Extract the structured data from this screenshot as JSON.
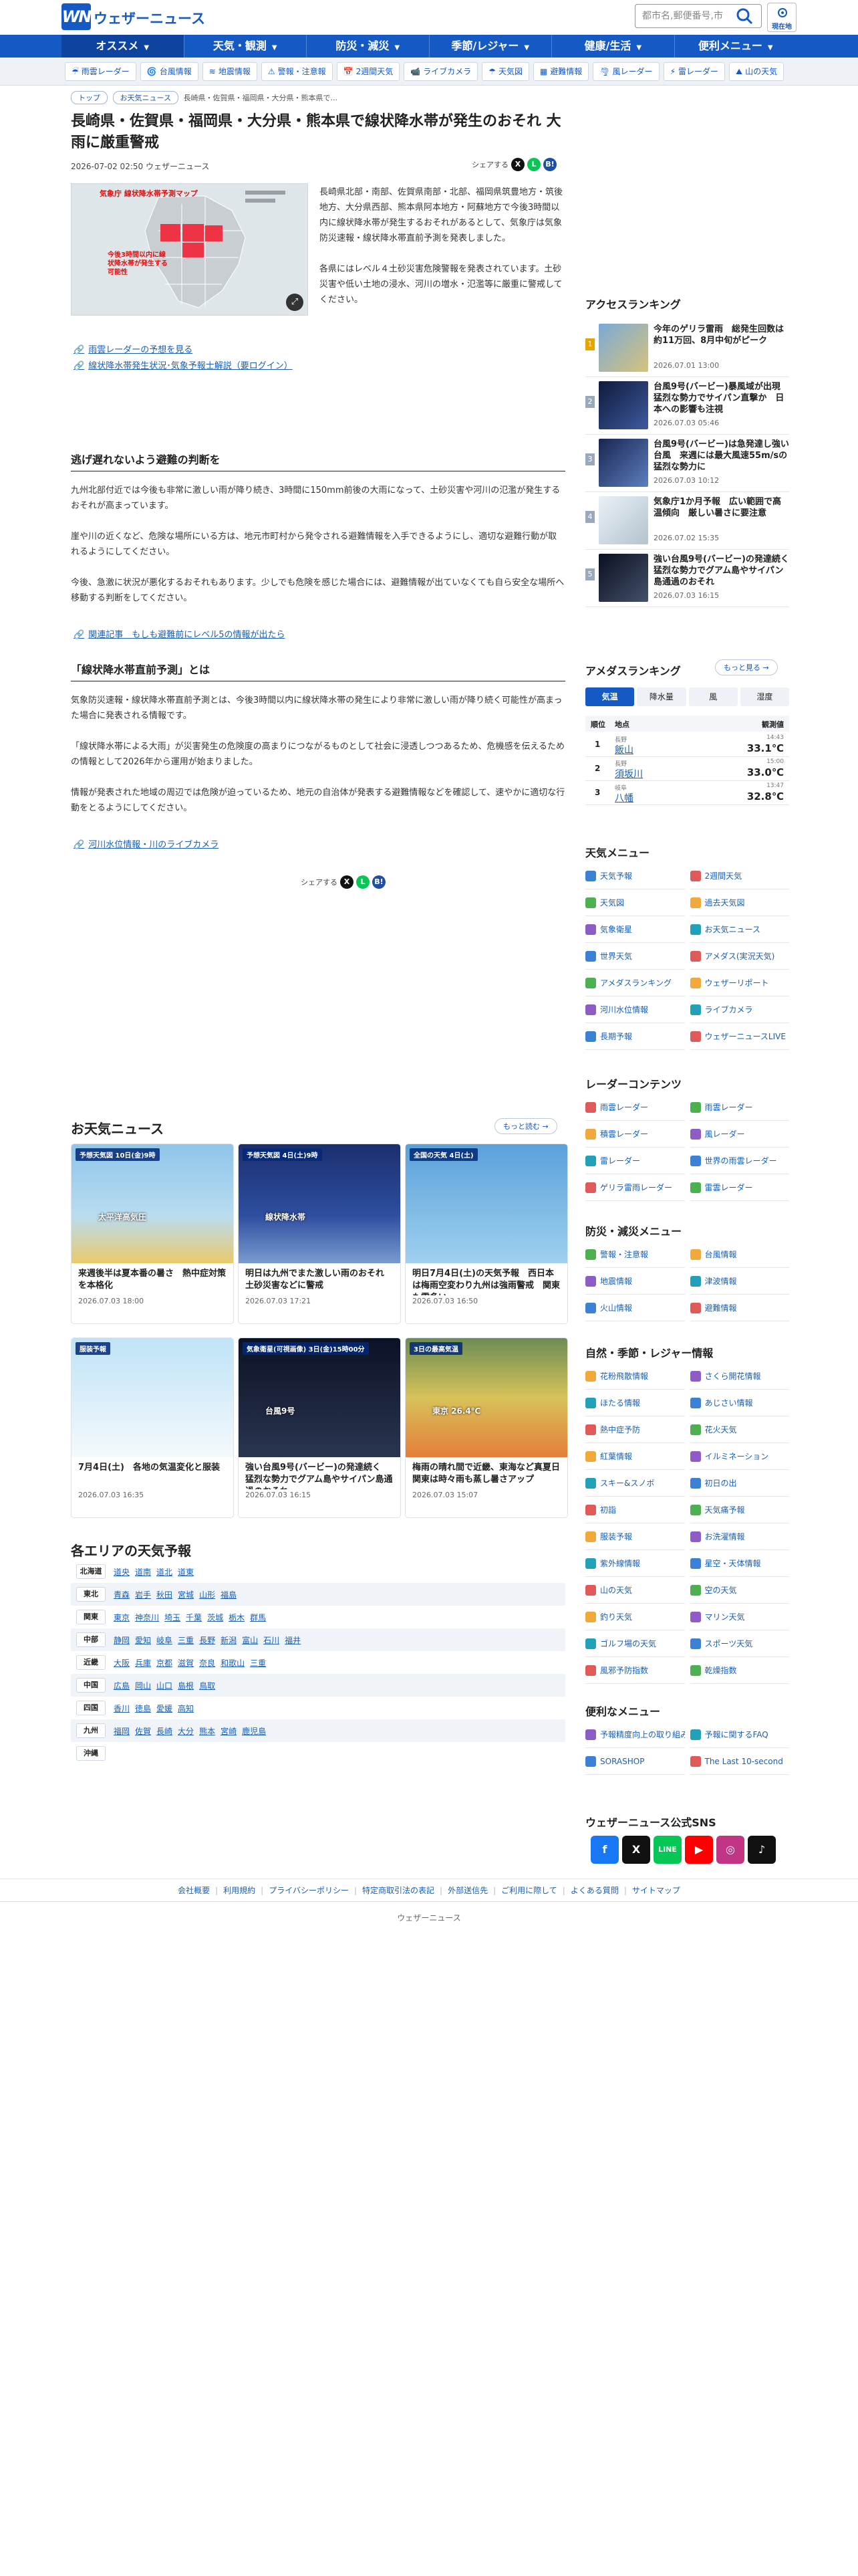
{
  "header": {
    "logo_text": "ウェザーニュース",
    "search_placeholder": "都市名,郵便番号,市",
    "location_label": "現在地"
  },
  "gnav": [
    "オススメ",
    "天気・観測",
    "防災・減災",
    "季節/レジャー",
    "健康/生活",
    "便利メニュー"
  ],
  "subnav": [
    {
      "icon": "☔",
      "label": "雨雲レーダー"
    },
    {
      "icon": "🌀",
      "label": "台風情報"
    },
    {
      "icon": "≋",
      "label": "地震情報"
    },
    {
      "icon": "⚠",
      "label": "警報・注意報"
    },
    {
      "icon": "📅",
      "label": "2週間天気"
    },
    {
      "icon": "📹",
      "label": "ライブカメラ"
    },
    {
      "icon": "☂",
      "label": "天気図"
    },
    {
      "icon": "▦",
      "label": "避難情報"
    },
    {
      "icon": "🌪",
      "label": "風レーダー"
    },
    {
      "icon": "⚡",
      "label": "雷レーダー"
    },
    {
      "icon": "⛰",
      "label": "山の天気"
    }
  ],
  "breadcrumb": [
    "トップ",
    "お天気ニュース",
    "長崎県・佐賀県・福岡県・大分県・熊本県で..."
  ],
  "article": {
    "title": "長崎県・佐賀県・福岡県・大分県・熊本県で線状降水帯が発生のおそれ 大雨に厳重警戒",
    "meta": "2026-07-02 02:50 ウェザーニュース",
    "share_label": "シェアする",
    "figure_caption": "気象庁 線状降水帯予測マップ",
    "figure_note": "今後3時間以内に線状降水帯が発生する可能性",
    "lead": [
      "長崎県北部・南部、佐賀県南部・北部、福岡県筑豊地方・筑後地方、大分県西部、熊本県阿本地方・阿蘇地方で今後3時間以内に線状降水帯が発生するおそれがあるとして、気象庁は気象防災速報・線状降水帯直前予測を発表しました。",
      "各県にはレベル４土砂災害危険警報を発表されています。土砂災害や低い土地の浸水、河川の増水・氾濫等に厳重に警戒してください。"
    ],
    "links1": [
      "雨雲レーダーの予想を見る",
      "線状降水帯発生状況･気象予報士解説（要ログイン）"
    ],
    "section1_title": "逃げ遅れないよう避難の判断を",
    "section1": [
      "九州北部付近では今後も非常に激しい雨が降り続き、3時間に150mm前後の大雨になって、土砂災害や河川の氾濫が発生するおそれが高まっています。",
      "崖や川の近くなど、危険な場所にいる方は、地元市町村から発令される避難情報を入手できるようにし、適切な避難行動が取れるようにしてください。",
      "今後、急激に状況が悪化するおそれもあります。少しでも危険を感じた場合には、避難情報が出ていなくても自ら安全な場所へ移動する判断をしてください。"
    ],
    "related": "関連記事　もしも避難前にレベル5の情報が出たら",
    "section2_title": "「線状降水帯直前予測」とは",
    "section2": [
      "気象防災速報・線状降水帯直前予測とは、今後3時間以内に線状降水帯の発生により非常に激しい雨が降り続く可能性が高まった場合に発表される情報です。",
      "「線状降水帯による大雨」が災害発生の危険度の高まりにつながるものとして社会に浸透しつつあるため、危機感を伝えるための情報として2026年から運用が始まりました。",
      "情報が発表された地域の周辺では危険が迫っているため、地元の自治体が発表する避難情報などを確認して、速やかに適切な行動をとるようにしてください。"
    ],
    "link2": "河川水位情報・川のライブカメラ"
  },
  "news": {
    "heading": "お天気ニュース",
    "more_label": "もっと読む",
    "cards": [
      {
        "title": "来週後半は夏本番の暑さ　熱中症対策を本格化",
        "date": "2026.07.03 18:00",
        "overlay": "予想天気図 10日(金)9時",
        "tag": "太平洋高気圧"
      },
      {
        "title": "明日は九州でまた激しい雨のおそれ　土砂災害などに警戒",
        "date": "2026.07.03 17:21",
        "overlay": "予想天気図 4日(土)9時",
        "tag": "線状降水帯"
      },
      {
        "title": "明日7月4日(土)の天気予報　西日本は梅雨空変わり九州は強雨警戒　関東も雲多い",
        "date": "2026.07.03 16:50",
        "overlay": "全国の天気 4日(土)",
        "tag": ""
      },
      {
        "title": "7月4日(土)　各地の気温変化と服装",
        "date": "2026.07.03 16:35",
        "overlay": "服装予報",
        "tag": ""
      },
      {
        "title": "強い台風9号(バービー)の発達続く　猛烈な勢力でグアム島やサイパン島通過のおそれ",
        "date": "2026.07.03 16:15",
        "overlay": "気象衛星(可視画像) 3日(金)15時00分",
        "tag": "台風9号"
      },
      {
        "title": "梅雨の晴れ間で近畿、東海など真夏日　関東は時々雨も蒸し暑さアップ",
        "date": "2026.07.03 15:07",
        "overlay": "3日の最高気温",
        "tag": "東京 26.4℃"
      }
    ]
  },
  "areas": {
    "heading": "各エリアの天気予報",
    "rows": [
      {
        "region": "北海道",
        "prefs": [
          "道央",
          "道南",
          "道北",
          "道東"
        ]
      },
      {
        "region": "東北",
        "prefs": [
          "青森",
          "岩手",
          "秋田",
          "宮城",
          "山形",
          "福島"
        ]
      },
      {
        "region": "関東",
        "prefs": [
          "東京",
          "神奈川",
          "埼玉",
          "千葉",
          "茨城",
          "栃木",
          "群馬"
        ]
      },
      {
        "region": "中部",
        "prefs": [
          "静岡",
          "愛知",
          "岐阜",
          "三重",
          "長野",
          "新潟",
          "富山",
          "石川",
          "福井"
        ]
      },
      {
        "region": "近畿",
        "prefs": [
          "大阪",
          "兵庫",
          "京都",
          "滋賀",
          "奈良",
          "和歌山",
          "三重"
        ]
      },
      {
        "region": "中国",
        "prefs": [
          "広島",
          "岡山",
          "山口",
          "島根",
          "鳥取"
        ]
      },
      {
        "region": "四国",
        "prefs": [
          "香川",
          "徳島",
          "愛媛",
          "高知"
        ]
      },
      {
        "region": "九州",
        "prefs": [
          "福岡",
          "佐賀",
          "長崎",
          "大分",
          "熊本",
          "宮崎",
          "鹿児島"
        ]
      },
      {
        "region": "沖縄",
        "prefs": []
      }
    ]
  },
  "ranking": {
    "heading": "アクセスランキング",
    "items": [
      {
        "rank": "1",
        "title": "今年のゲリラ雷雨　総発生回数は約11万回、8月中旬がピーク",
        "date": "2026.07.01 13:00"
      },
      {
        "rank": "2",
        "title": "台風9号(バービー)暴風域が出現　猛烈な勢力でサイパン直撃か　日本への影響も注視",
        "date": "2026.07.03 05:46"
      },
      {
        "rank": "3",
        "title": "台風9号(バービー)は急発達し強い台風　来週には最大風速55m/sの猛烈な勢力に",
        "date": "2026.07.03 10:12"
      },
      {
        "rank": "4",
        "title": "気象庁1か月予報　広い範囲で高温傾向　厳しい暑さに要注意",
        "date": "2026.07.02 15:35"
      },
      {
        "rank": "5",
        "title": "強い台風9号(バービー)の発達続く　猛烈な勢力でグアム島やサイパン島通過のおそれ",
        "date": "2026.07.03 16:15"
      }
    ]
  },
  "amedas": {
    "heading": "アメダスランキング",
    "more_label": "もっと見る",
    "tabs": [
      "気温",
      "降水量",
      "風",
      "湿度"
    ],
    "cols": [
      "順位",
      "地点",
      "観測値"
    ],
    "rows": [
      {
        "rank": "1",
        "pref": "長野",
        "place": "飯山",
        "time": "14:43",
        "value": "33.1℃"
      },
      {
        "rank": "2",
        "pref": "長野",
        "place": "須坂川",
        "time": "15:00",
        "value": "33.0℃"
      },
      {
        "rank": "3",
        "pref": "岐阜",
        "place": "八幡",
        "time": "13:47",
        "value": "32.8℃"
      }
    ]
  },
  "menus": [
    {
      "heading": "天気メニュー",
      "items": [
        "天気予報",
        "2週間天気",
        "天気図",
        "過去天気図",
        "気象衛星",
        "お天気ニュース",
        "世界天気",
        "アメダス(実況天気)",
        "アメダスランキング",
        "ウェザーリポート",
        "河川水位情報",
        "ライブカメラ",
        "長期予報",
        "ウェザーニュースLIVE"
      ]
    },
    {
      "heading": "レーダーコンテンツ",
      "items": [
        "雨雲レーダー",
        "雨雲レーダー",
        "積雲レーダー",
        "風レーダー",
        "雷レーダー",
        "世界の雨雲レーダー",
        "ゲリラ雷雨レーダー",
        "雷雲レーダー"
      ]
    },
    {
      "heading": "防災・減災メニュー",
      "items": [
        "警報・注意報",
        "台風情報",
        "地震情報",
        "津波情報",
        "火山情報",
        "避難情報"
      ]
    },
    {
      "heading": "自然・季節・レジャー情報",
      "items": [
        "花粉飛散情報",
        "さくら開花情報",
        "ほたる情報",
        "あじさい情報",
        "熱中症予防",
        "花火天気",
        "紅葉情報",
        "イルミネーション",
        "スキー&スノボ",
        "初日の出",
        "初詣",
        "天気痛予報",
        "服装予報",
        "お洗濯情報",
        "紫外線情報",
        "星空・天体情報",
        "山の天気",
        "空の天気",
        "釣り天気",
        "マリン天気",
        "ゴルフ場の天気",
        "スポーツ天気",
        "風邪予防指数",
        "乾燥指数"
      ]
    },
    {
      "heading": "便利なメニュー",
      "items": [
        "予報精度向上の取り組み",
        "予報に関するFAQ",
        "SORASHOP",
        "The Last 10-second"
      ]
    }
  ],
  "sns_heading": "ウェザーニュース公式SNS",
  "footer": {
    "links": [
      "会社概要",
      "利用規約",
      "プライバシーポリシー",
      "特定商取引法の表記",
      "外部送信先",
      "ご利用に際して",
      "よくある質問",
      "サイトマップ"
    ],
    "brand": "ウェザーニュース"
  },
  "colors": {
    "brand": "#1559c4",
    "link": "#1a5fb4"
  }
}
